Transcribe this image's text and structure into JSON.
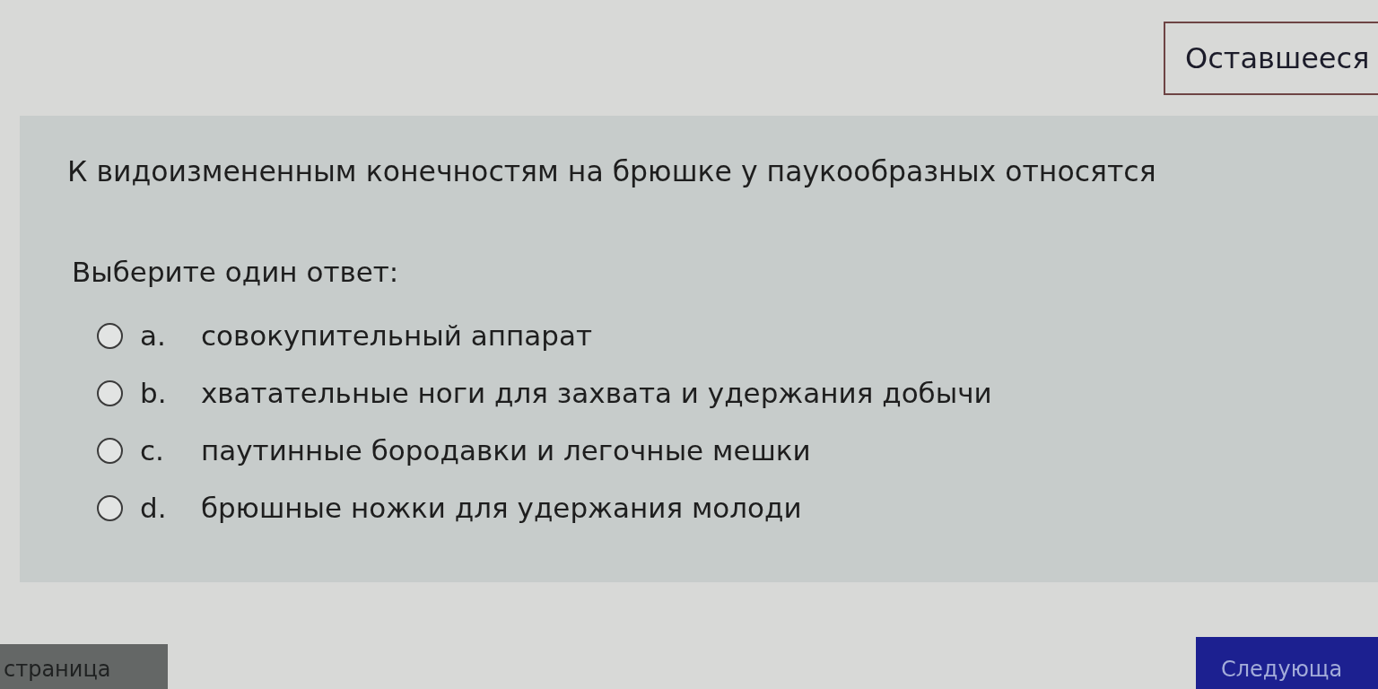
{
  "timer": {
    "label": "Оставшееся"
  },
  "question": {
    "text": "К видоизмененным конечностям на брюшке у паукообразных относятся",
    "prompt": "Выберите один ответ:",
    "options": [
      {
        "letter": "a.",
        "text": "совокупительный аппарат",
        "selected": false
      },
      {
        "letter": "b.",
        "text": "хватательные ноги для захвата и удержания добычи",
        "selected": false
      },
      {
        "letter": "c.",
        "text": "паутинные бородавки и легочные мешки",
        "selected": false
      },
      {
        "letter": "d.",
        "text": "брюшные ножки для удержания молоди",
        "selected": false
      }
    ]
  },
  "navigation": {
    "previous": "страница",
    "next": "Следующа"
  }
}
